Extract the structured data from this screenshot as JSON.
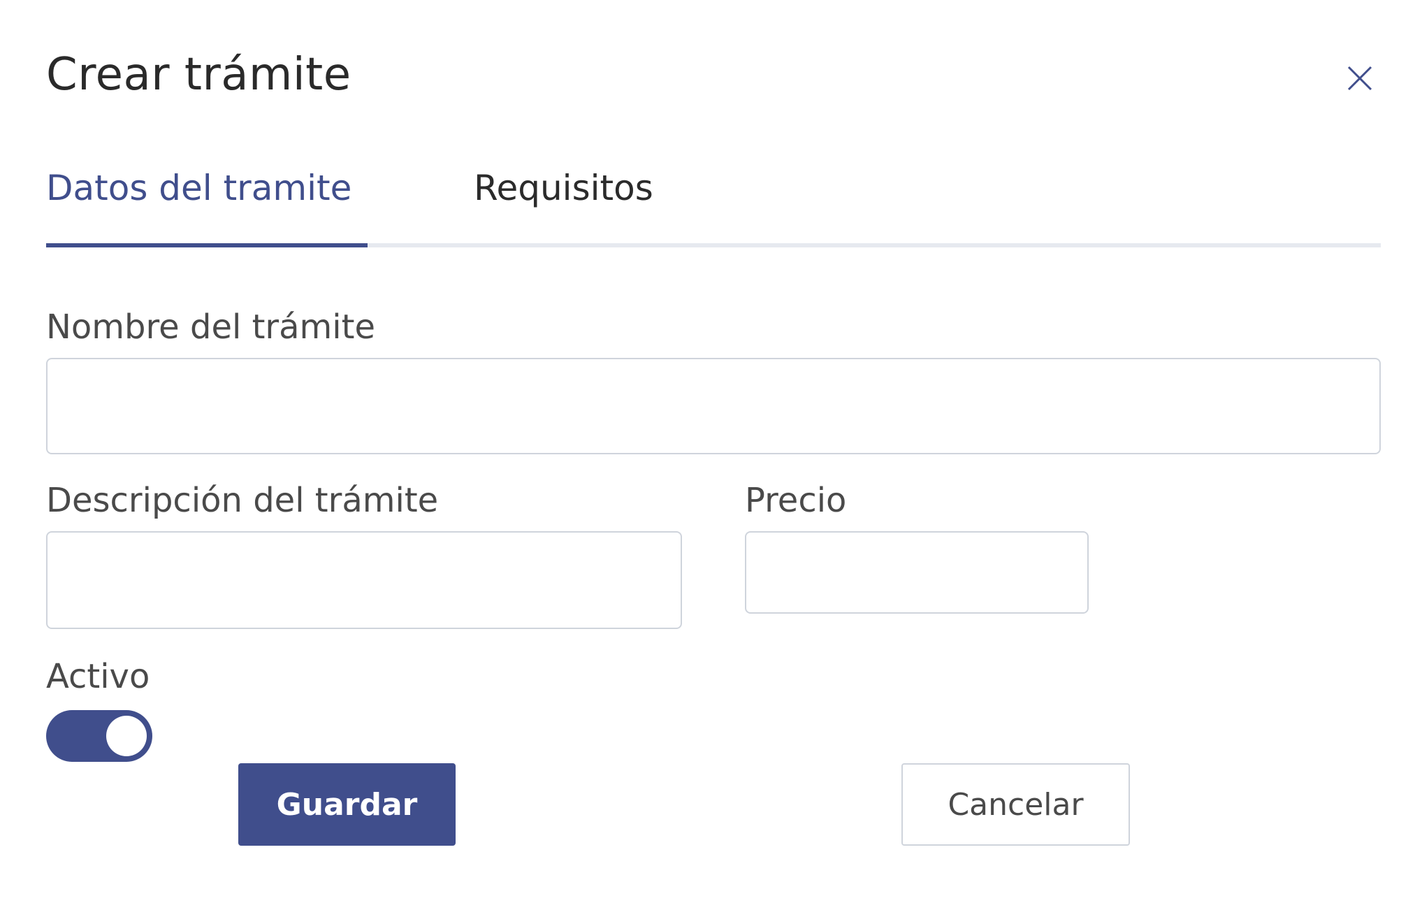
{
  "dialog": {
    "title": "Crear trámite",
    "close_icon": "close-icon"
  },
  "tabs": [
    {
      "label": "Datos del tramite",
      "active": true
    },
    {
      "label": "Requisitos",
      "active": false
    }
  ],
  "form": {
    "nombre": {
      "label": "Nombre del trámite",
      "value": "",
      "placeholder": ""
    },
    "descripcion": {
      "label": "Descripción del trámite",
      "value": "",
      "placeholder": ""
    },
    "precio": {
      "label": "Precio",
      "value": "",
      "placeholder": ""
    },
    "activo": {
      "label": "Activo",
      "checked": true
    }
  },
  "actions": {
    "save_label": "Guardar",
    "cancel_label": "Cancelar"
  },
  "colors": {
    "accent": "#404e8c",
    "border": "#cfd4dc",
    "tab_divider": "#e6e9ef"
  }
}
